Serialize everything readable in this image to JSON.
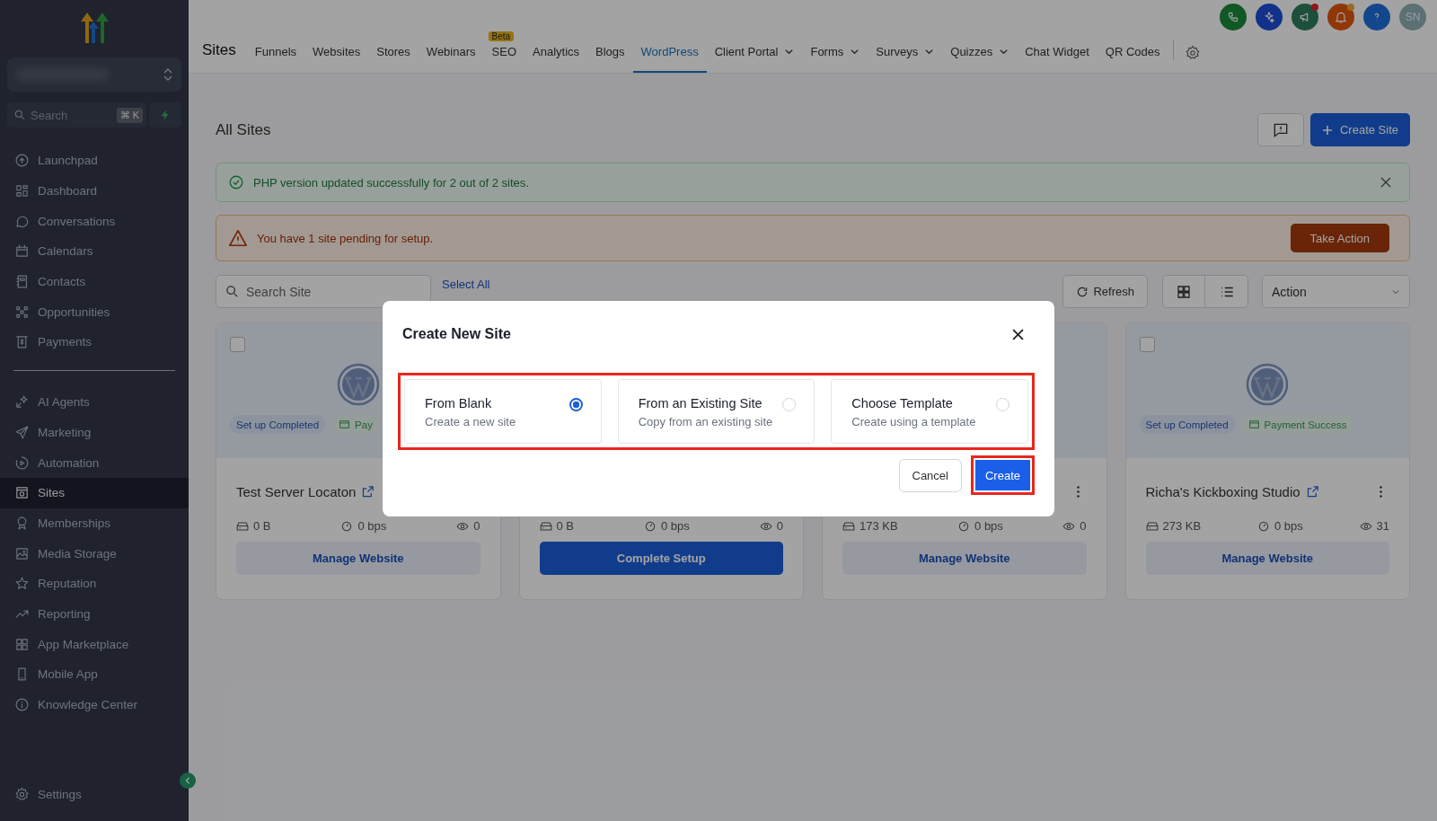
{
  "sidebar": {
    "search": {
      "placeholder": "Search",
      "shortcut": "⌘ K"
    },
    "groups": [
      [
        {
          "label": "Launchpad",
          "selected": false
        },
        {
          "label": "Dashboard",
          "selected": false
        },
        {
          "label": "Conversations",
          "selected": false
        },
        {
          "label": "Calendars",
          "selected": false
        },
        {
          "label": "Contacts",
          "selected": false
        },
        {
          "label": "Opportunities",
          "selected": false
        },
        {
          "label": "Payments",
          "selected": false
        }
      ],
      [
        {
          "label": "AI Agents",
          "selected": false
        },
        {
          "label": "Marketing",
          "selected": false
        },
        {
          "label": "Automation",
          "selected": false
        },
        {
          "label": "Sites",
          "selected": true
        },
        {
          "label": "Memberships",
          "selected": false
        },
        {
          "label": "Media Storage",
          "selected": false
        },
        {
          "label": "Reputation",
          "selected": false
        },
        {
          "label": "Reporting",
          "selected": false
        },
        {
          "label": "App Marketplace",
          "selected": false
        },
        {
          "label": "Mobile App",
          "selected": false
        },
        {
          "label": "Knowledge Center",
          "selected": false
        }
      ]
    ],
    "settings": "Settings"
  },
  "top_bar": {
    "avatar": "SN"
  },
  "nav": {
    "title": "Sites",
    "tabs": [
      {
        "label": "Funnels",
        "selected": false
      },
      {
        "label": "Websites",
        "selected": false
      },
      {
        "label": "Stores",
        "selected": false
      },
      {
        "label": "Webinars",
        "selected": false
      },
      {
        "label": "SEO",
        "selected": false,
        "badge": "Beta"
      },
      {
        "label": "Analytics",
        "selected": false
      },
      {
        "label": "Blogs",
        "selected": false
      },
      {
        "label": "WordPress",
        "selected": true
      },
      {
        "label": "Client Portal",
        "selected": false,
        "dropdown": true
      },
      {
        "label": "Forms",
        "selected": false,
        "dropdown": true
      },
      {
        "label": "Surveys",
        "selected": false,
        "dropdown": true
      },
      {
        "label": "Quizzes",
        "selected": false,
        "dropdown": true
      },
      {
        "label": "Chat Widget",
        "selected": false
      },
      {
        "label": "QR Codes",
        "selected": false
      }
    ]
  },
  "page": {
    "title": "All Sites",
    "create_button": "Create Site",
    "alerts": [
      {
        "kind": "success",
        "text": "PHP version updated successfully for 2 out of 2 sites.",
        "dismissible": true
      },
      {
        "kind": "warning",
        "text": "You have 1 site pending for setup.",
        "action": "Take Action"
      }
    ],
    "toolbar": {
      "search_placeholder": "Search Site",
      "select_all": "Select All",
      "refresh": "Refresh",
      "action_placeholder": "Action"
    }
  },
  "cards": [
    {
      "checked": false,
      "badges": [
        {
          "kind": "setup",
          "text": "Set up Completed"
        },
        {
          "kind": "payment",
          "text": "Pay"
        }
      ],
      "name": "Test Server Locaton",
      "stats": [
        "0 B",
        "0 bps",
        "0"
      ],
      "action": {
        "kind": "secondary",
        "label": "Manage Website"
      }
    },
    {
      "stats": [
        "0 B",
        "0 bps",
        "0"
      ],
      "action": {
        "kind": "primary",
        "label": "Complete Setup"
      }
    },
    {
      "menu": true,
      "stats": [
        "173 KB",
        "0 bps",
        "0"
      ],
      "action": {
        "kind": "secondary",
        "label": "Manage Website"
      }
    },
    {
      "checked": false,
      "menu": true,
      "badges": [
        {
          "kind": "setup",
          "text": "Set up Completed"
        },
        {
          "kind": "payment",
          "text": "Payment Success"
        }
      ],
      "name": "Richa's Kickboxing Studio",
      "stats": [
        "273 KB",
        "0 bps",
        "31"
      ],
      "action": {
        "kind": "secondary",
        "label": "Manage Website"
      }
    }
  ],
  "modal": {
    "title": "Create New Site",
    "options_highlighted": true,
    "options": [
      {
        "title": "From Blank",
        "subtitle": "Create a new site",
        "selected": true
      },
      {
        "title": "From an Existing Site",
        "subtitle": "Copy from an existing site",
        "selected": false
      },
      {
        "title": "Choose Template",
        "subtitle": "Create using a template",
        "selected": false
      }
    ],
    "cancel": "Cancel",
    "create": "Create",
    "create_highlighted": true
  }
}
